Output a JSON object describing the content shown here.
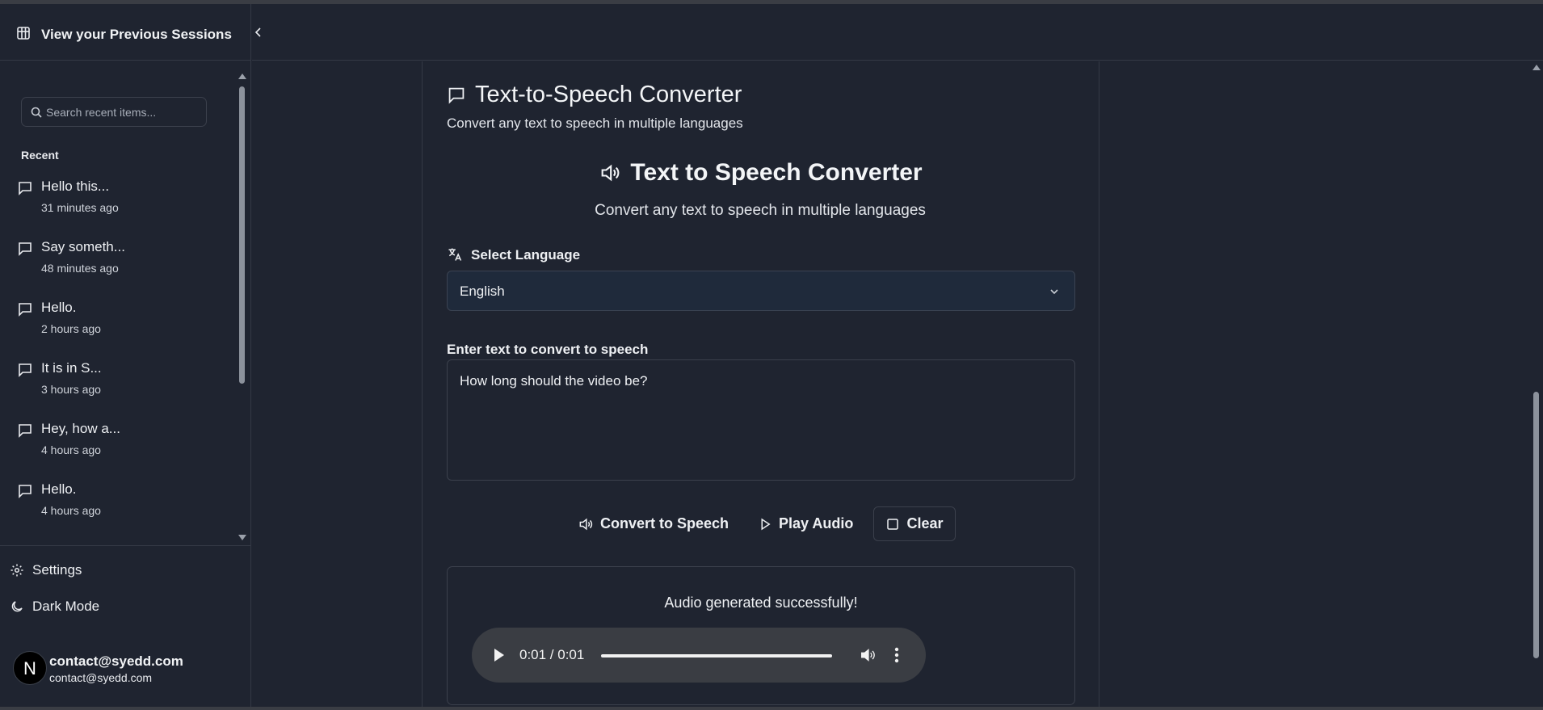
{
  "sidebar": {
    "title": "View your Previous Sessions",
    "search_placeholder": "Search recent items...",
    "recent_label": "Recent",
    "items": [
      {
        "title": "Hello this...",
        "time": "31 minutes ago"
      },
      {
        "title": "Say someth...",
        "time": "48 minutes ago"
      },
      {
        "title": "Hello.",
        "time": "2 hours ago"
      },
      {
        "title": "It is in S...",
        "time": "3 hours ago"
      },
      {
        "title": "Hey, how a...",
        "time": "4 hours ago"
      },
      {
        "title": "Hello.",
        "time": "4 hours ago"
      }
    ],
    "settings_label": "Settings",
    "dark_mode_label": "Dark Mode",
    "user": {
      "initial": "N",
      "name": "contact@syedd.com",
      "email": "contact@syedd.com"
    }
  },
  "main": {
    "app_title": "Text-to-Speech Converter",
    "app_subtitle": "Convert any text to speech in multiple languages",
    "converter_title": "Text to Speech Converter",
    "converter_subtitle": "Convert any text to speech in multiple languages",
    "language_label": "Select Language",
    "language_value": "English",
    "text_label": "Enter text to convert to speech",
    "text_value": "How long should the video be?",
    "buttons": {
      "convert": "Convert to Speech",
      "play": "Play Audio",
      "clear": "Clear"
    },
    "audio_status": "Audio generated successfully!",
    "player": {
      "time": "0:01 / 0:01",
      "progress": 1.0
    }
  },
  "icons": [
    "grid-icon",
    "chevron-left-icon",
    "search-icon",
    "message-icon",
    "gear-icon",
    "moon-icon",
    "speaker-icon",
    "translate-icon",
    "chevron-down-icon",
    "play-icon",
    "square-icon",
    "volume-icon",
    "more-vertical-icon"
  ]
}
